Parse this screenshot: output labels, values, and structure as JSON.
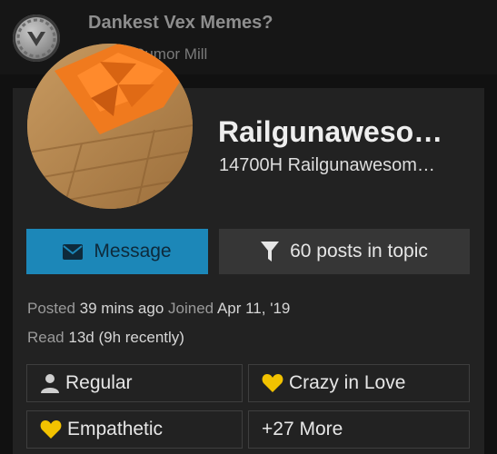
{
  "header": {
    "topic_title": "Dankest Vex Memes?",
    "category": "Chat / Rumor Mill"
  },
  "user_card": {
    "username": "Railgunaweso…",
    "full_name": "14700H Railgunawesom…",
    "message_button": "Message",
    "posts_button": "60 posts in topic",
    "posted_label": "Posted",
    "posted_value": "39 mins ago",
    "joined_label": "Joined",
    "joined_value": "Apr 11, '19",
    "read_label": "Read",
    "read_value": "13d (9h recently)",
    "badges": [
      {
        "label": "Regular",
        "icon": "user-icon"
      },
      {
        "label": "Crazy in Love",
        "icon": "heart-icon"
      },
      {
        "label": "Empathetic",
        "icon": "heart-icon"
      },
      {
        "label": "+27 More",
        "icon": ""
      }
    ]
  },
  "colors": {
    "message_button": "#1c87b8",
    "heart": "#f2c200",
    "background": "#111111",
    "card": "#222222"
  }
}
